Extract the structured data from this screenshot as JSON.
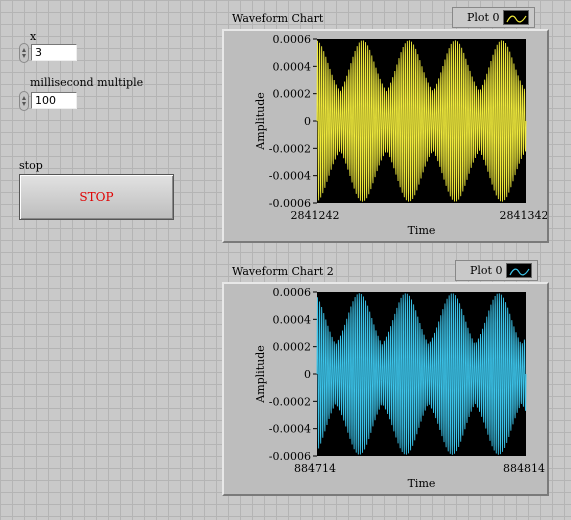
{
  "controls": {
    "x": {
      "label": "x",
      "value": "3"
    },
    "ms": {
      "label": "millisecond  multiple",
      "value": "100"
    },
    "stop": {
      "label": "stop",
      "button_text": "STOP"
    }
  },
  "charts": [
    {
      "title": "Waveform Chart",
      "legend": "Plot 0",
      "color": "#f0ea3c",
      "ylabel": "Amplitude",
      "xlabel": "Time",
      "y_ticks": [
        "0.0006",
        "0.0004",
        "0.0002",
        "0",
        "-0.0002",
        "-0.0004",
        "-0.0006"
      ],
      "x_ticks": [
        "2841242",
        "2841342"
      ]
    },
    {
      "title": "Waveform Chart 2",
      "legend": "Plot 0",
      "color": "#3cc4ea",
      "ylabel": "Amplitude",
      "xlabel": "Time",
      "y_ticks": [
        "0.0006",
        "0.0004",
        "0.0002",
        "0",
        "-0.0002",
        "-0.0004",
        "-0.0006"
      ],
      "x_ticks": [
        "884714",
        "884814"
      ]
    }
  ],
  "chart_data": [
    {
      "type": "line",
      "title": "Waveform Chart",
      "xlabel": "Time",
      "ylabel": "Amplitude",
      "xlim": [
        2841242,
        2841342
      ],
      "ylim": [
        -0.0006,
        0.0006
      ],
      "series": [
        {
          "name": "Plot 0",
          "color": "#f0ea3c",
          "description": "amplitude-modulated sinusoid, ~100 cycles, envelope alternating between 0.0006 and ~0.0004"
        }
      ]
    },
    {
      "type": "line",
      "title": "Waveform Chart 2",
      "xlabel": "Time",
      "ylabel": "Amplitude",
      "xlim": [
        884714,
        884814
      ],
      "ylim": [
        -0.0006,
        0.0006
      ],
      "series": [
        {
          "name": "Plot 0",
          "color": "#3cc4ea",
          "description": "amplitude-modulated sinusoid, ~100 cycles, envelope alternating between 0.0006 and ~0.0004"
        }
      ]
    }
  ]
}
